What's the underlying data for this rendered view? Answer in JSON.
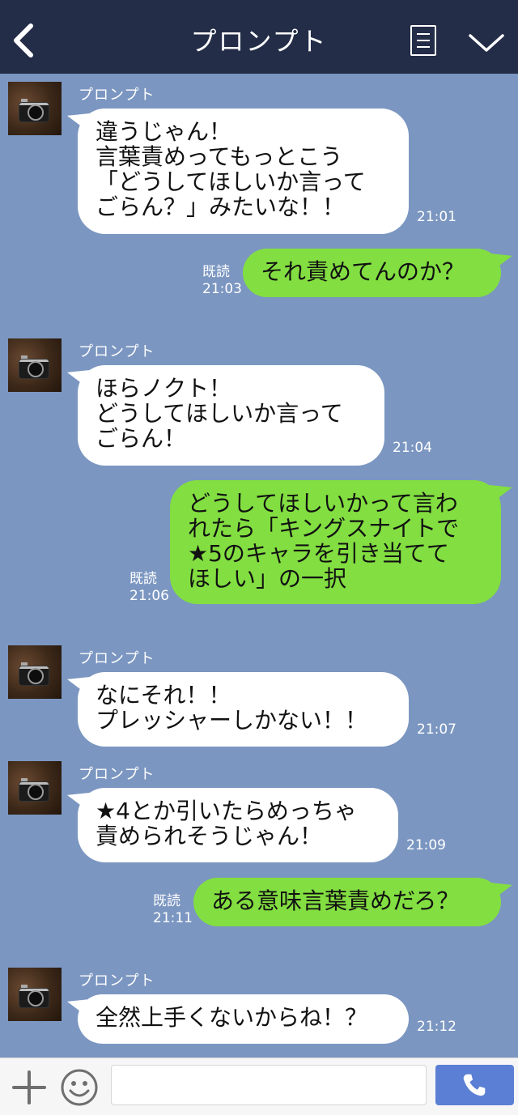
{
  "header": {
    "title": "プロンプト",
    "back_icon": "chevron-left-icon",
    "menu_icon": "notes-icon",
    "collapse_icon": "chevron-down-icon"
  },
  "colors": {
    "header_bg": "#232d48",
    "chat_bg": "#7b96c1",
    "incoming_bubble": "#ffffff",
    "outgoing_bubble": "#82de41",
    "call_button": "#5a7fd4"
  },
  "messages": [
    {
      "sender": "プロンプト",
      "lines": [
        "違うじゃん！",
        "言葉責めってもっとこう",
        "「どうしてほしいか言って",
        "ごらん？」みたいな！！"
      ],
      "time": "21:01"
    },
    {
      "lines": [
        "それ責めてんのか？"
      ],
      "read": "既読",
      "time": "21:03"
    },
    {
      "sender": "プロンプト",
      "lines": [
        "ほらノクト！",
        "どうしてほしいか言って",
        "ごらん！"
      ],
      "time": "21:04"
    },
    {
      "lines": [
        "どうしてほしいかって言わ",
        "れたら「キングスナイトで",
        "★5のキャラを引き当てて",
        "ほしい」の一択"
      ],
      "read": "既読",
      "time": "21:06"
    },
    {
      "sender": "プロンプト",
      "lines": [
        "なにそれ！！",
        "プレッシャーしかない！！"
      ],
      "time": "21:07"
    },
    {
      "sender": "プロンプト",
      "lines": [
        "★4とか引いたらめっちゃ",
        "責められそうじゃん！"
      ],
      "time": "21:09"
    },
    {
      "lines": [
        "ある意味言葉責めだろ？"
      ],
      "read": "既読",
      "time": "21:11"
    },
    {
      "sender": "プロンプト",
      "lines": [
        "全然上手くないからね！？"
      ],
      "time": "21:12"
    }
  ],
  "footer": {
    "plus_icon": "plus-icon",
    "emoji_icon": "smiley-icon",
    "input_value": "",
    "call_icon": "phone-icon"
  }
}
